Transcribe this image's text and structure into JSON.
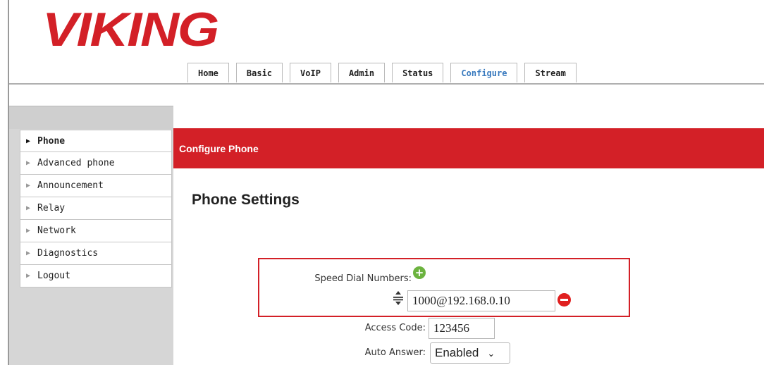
{
  "brand": {
    "logo_text": "VIKING",
    "color": "#d32027"
  },
  "tabs": [
    {
      "label": "Home"
    },
    {
      "label": "Basic"
    },
    {
      "label": "VoIP"
    },
    {
      "label": "Admin"
    },
    {
      "label": "Status"
    },
    {
      "label": "Configure",
      "active": true
    },
    {
      "label": "Stream"
    }
  ],
  "sidebar": {
    "items": [
      {
        "label": "Phone",
        "active": true
      },
      {
        "label": "Advanced phone"
      },
      {
        "label": "Announcement"
      },
      {
        "label": "Relay"
      },
      {
        "label": "Network"
      },
      {
        "label": "Diagnostics"
      },
      {
        "label": "Logout"
      }
    ]
  },
  "page": {
    "banner_title": "Configure Phone",
    "section_title": "Phone Settings"
  },
  "form": {
    "speed_dial_label": "Speed Dial Numbers:",
    "speed_dial_value": "1000@192.168.0.10",
    "access_code_label": "Access Code:",
    "access_code_value": "123456",
    "auto_answer_label": "Auto Answer:",
    "auto_answer_value": "Enabled"
  },
  "icons": {
    "add": "plus-circle-icon",
    "remove": "minus-circle-icon",
    "reorder": "drag-handle-icon",
    "chevron": "chevron-down-icon"
  }
}
